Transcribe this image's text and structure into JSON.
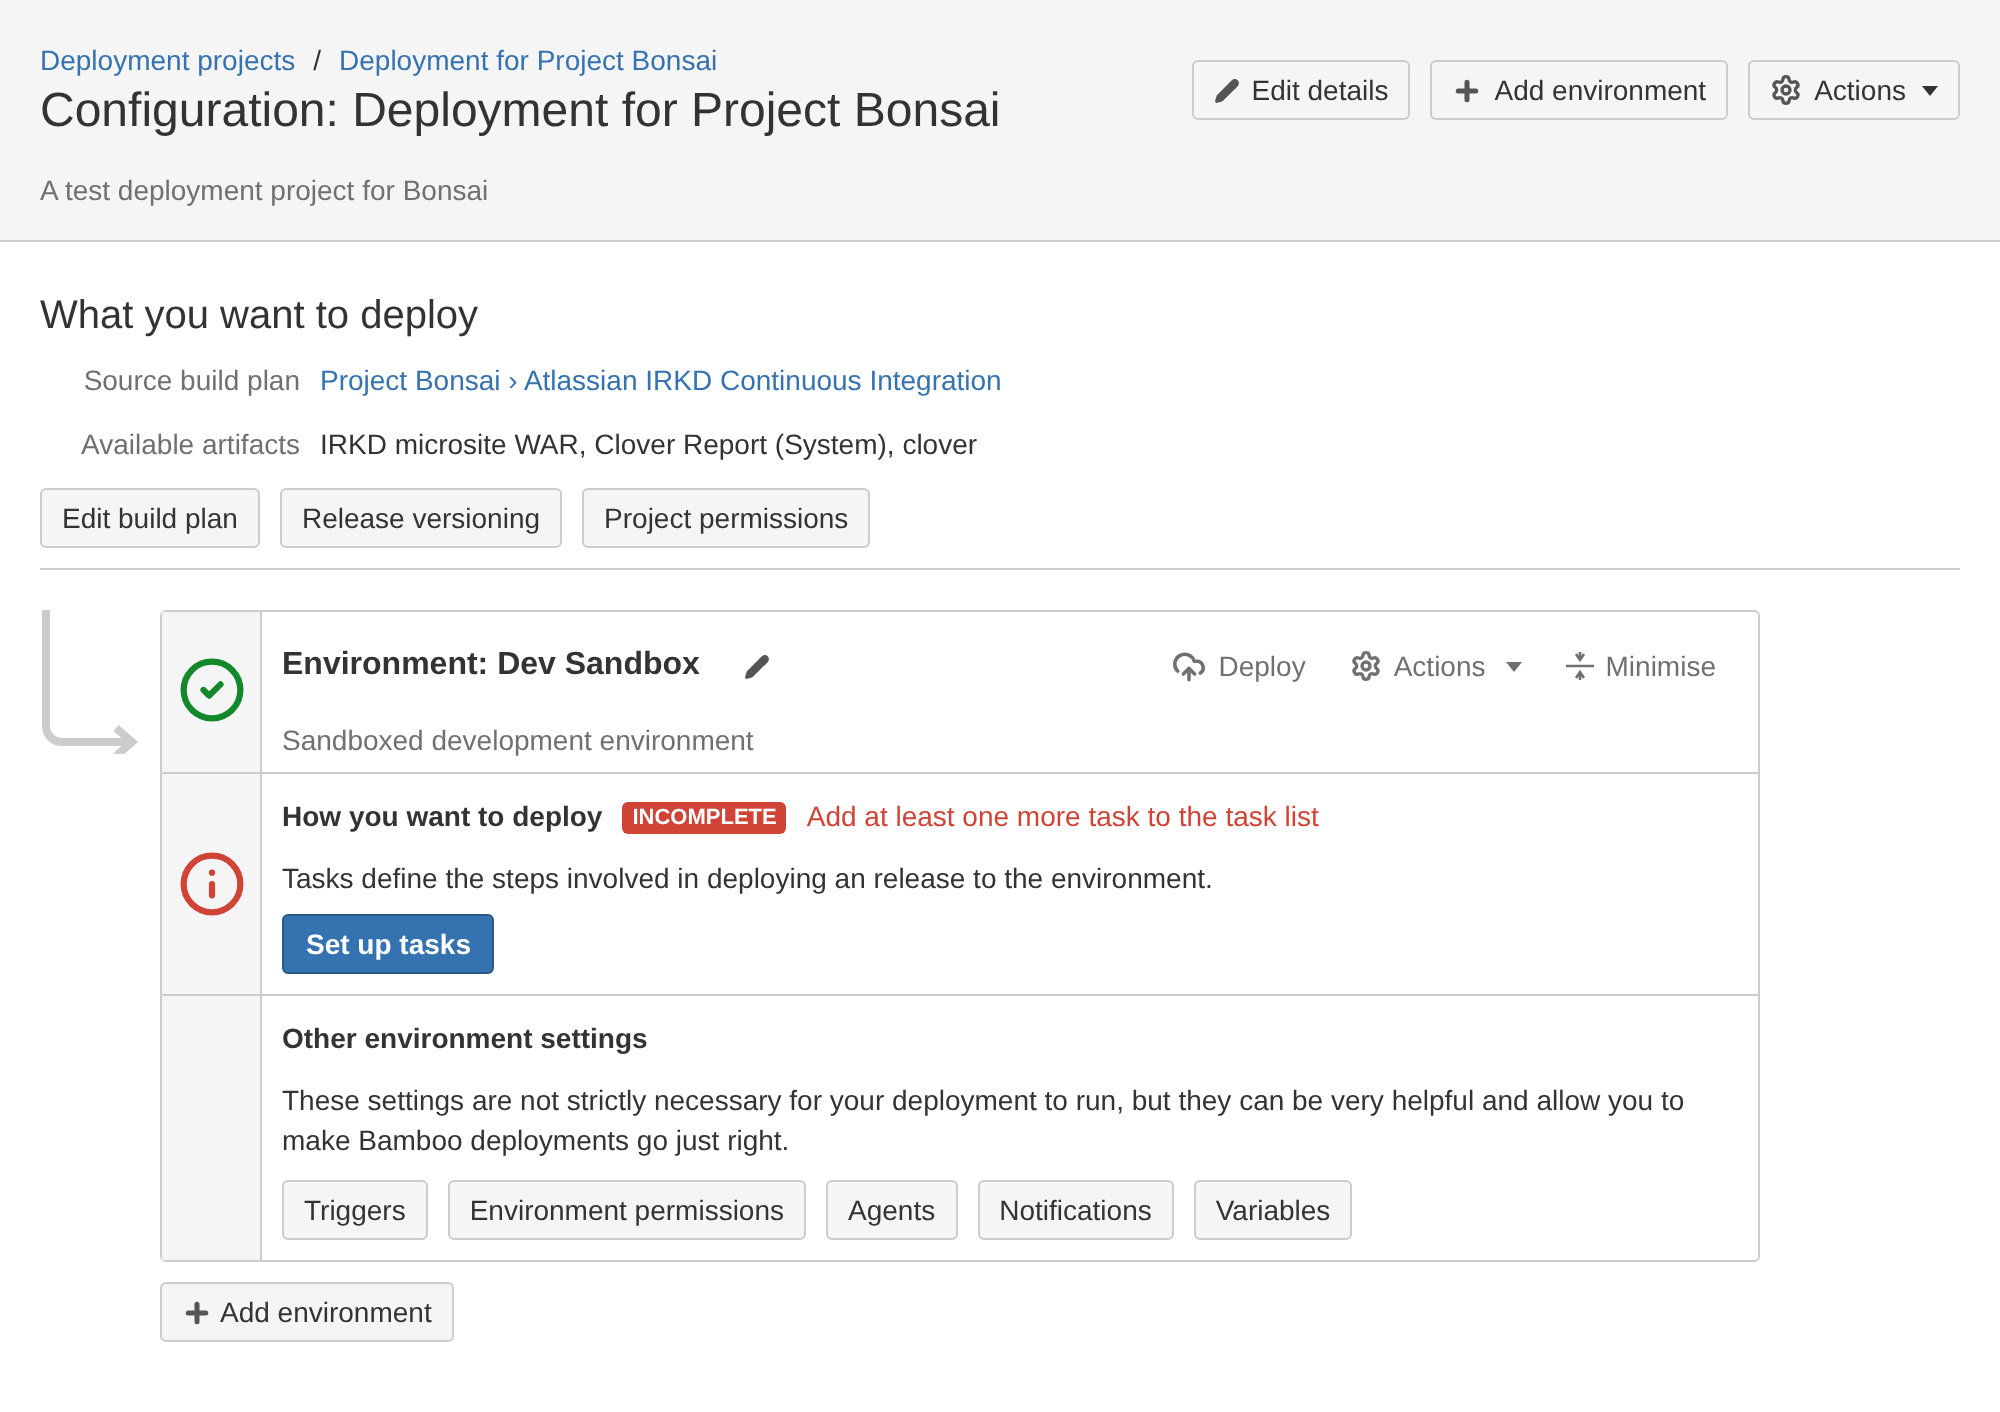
{
  "breadcrumbs": [
    "Deployment projects",
    "Deployment for Project Bonsai"
  ],
  "breadcrumb_separator": "/",
  "title": "Configuration: Deployment for Project Bonsai",
  "description": "A test deployment project for Bonsai",
  "header_buttons": [
    {
      "kind": "edit",
      "label": "Edit details"
    },
    {
      "kind": "add",
      "label": "Add environment"
    },
    {
      "kind": "actions",
      "label": "Actions"
    }
  ],
  "deploy_section": {
    "heading": "What you want to deploy",
    "fields": [
      {
        "label": "Source build plan",
        "value": "Project Bonsai › Atlassian IRKD Continuous Integration",
        "kind": "link"
      },
      {
        "label": "Available artifacts",
        "value": "IRKD microsite WAR, Clover Report (System), clover",
        "kind": "text"
      }
    ],
    "buttons": [
      "Edit build plan",
      "Release versioning",
      "Project permissions"
    ]
  },
  "environment": {
    "title": "Environment: Dev Sandbox",
    "description": "Sandboxed development environment",
    "actions": [
      {
        "kind": "deploy",
        "label": "Deploy"
      },
      {
        "kind": "actions",
        "label": "Actions"
      },
      {
        "kind": "minimise",
        "label": "Minimise"
      }
    ],
    "sections": [
      {
        "kind": "incomplete",
        "heading": "How you want to deploy",
        "badge": "INCOMPLETE",
        "warning": "Add at least one more task to the task list",
        "text": "Tasks define the steps involved in deploying an release to the environment.",
        "primary_button": "Set up tasks"
      },
      {
        "kind": "plain",
        "heading": "Other environment settings",
        "text": "These settings are not strictly necessary for your deployment to run, but they can be very helpful and allow you to make Bamboo deployments go just right.",
        "buttons": [
          "Triggers",
          "Environment permissions",
          "Agents",
          "Notifications",
          "Variables"
        ]
      }
    ],
    "kind": "complete"
  },
  "add_environment_button": "Add environment"
}
